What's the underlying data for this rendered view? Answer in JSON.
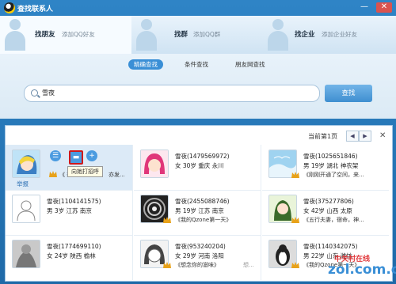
{
  "window": {
    "title": "查找联系人",
    "min_glyph": "—",
    "close_glyph": "✕"
  },
  "top_tabs": [
    {
      "label": "找朋友",
      "sub": "添加QQ好友"
    },
    {
      "label": "找群",
      "sub": "添加QQ群"
    },
    {
      "label": "找企业",
      "sub": "添加企业好友"
    }
  ],
  "mode_tabs": [
    "精确查找",
    "条件查找",
    "朋友网查找"
  ],
  "search": {
    "value": "雪夜",
    "button": "查找"
  },
  "pager": {
    "label": "当前第1页",
    "prev": "◀",
    "next": "▶",
    "close": "✕"
  },
  "hover_card": {
    "report": "举报",
    "tooltip": "向她打招呼",
    "feed_prefix": "《 转",
    "feed_tail": "亦发..."
  },
  "results": [
    {
      "name": "",
      "info": "",
      "feed": "",
      "avatar": "anime-blue",
      "hover": true
    },
    {
      "name": "雪夜(1479569972)",
      "info": "女 30岁 重庆 永川",
      "feed": "",
      "avatar": "anime-pink"
    },
    {
      "name": "雪夜(1025651846)",
      "info": "男 19岁 湖北 神农架",
      "feed": "《刚刚开通了空间，来...",
      "avatar": "sky"
    },
    {
      "name": "雪夜(1104141575)",
      "info": "男 3岁 江苏 南京",
      "feed": "",
      "avatar": "silhouette"
    },
    {
      "name": "雪夜(2455088746)",
      "info": "男 19岁 江苏 南京",
      "feed": "《我的Qzone第一天》",
      "avatar": "swirl"
    },
    {
      "name": "雪夜(375277806)",
      "info": "女 42岁 山西 太原",
      "feed": "《五行夫妻，宿命，神...",
      "avatar": "anime-green"
    },
    {
      "name": "雪夜(1774699110)",
      "info": "女 24岁 陕西 榆林",
      "feed": "",
      "avatar": "gray"
    },
    {
      "name": "雪夜(953240204)",
      "info": "女 29岁 河南 洛阳",
      "feed": "《想念你的滋味》",
      "feed_tail": "想...",
      "avatar": "anime-bw"
    },
    {
      "name": "雪夜(1140342075)",
      "info": "男 22岁 山东 潍坊",
      "feed": "《我的Qzone第一天》",
      "avatar": "penguin"
    }
  ],
  "watermark": {
    "top": "中关村在线",
    "bottom": "zol.com.cn"
  },
  "colors": {
    "accent": "#3a8fd6",
    "title_bar": "#2f84c6",
    "highlight_border": "#d0181b"
  }
}
